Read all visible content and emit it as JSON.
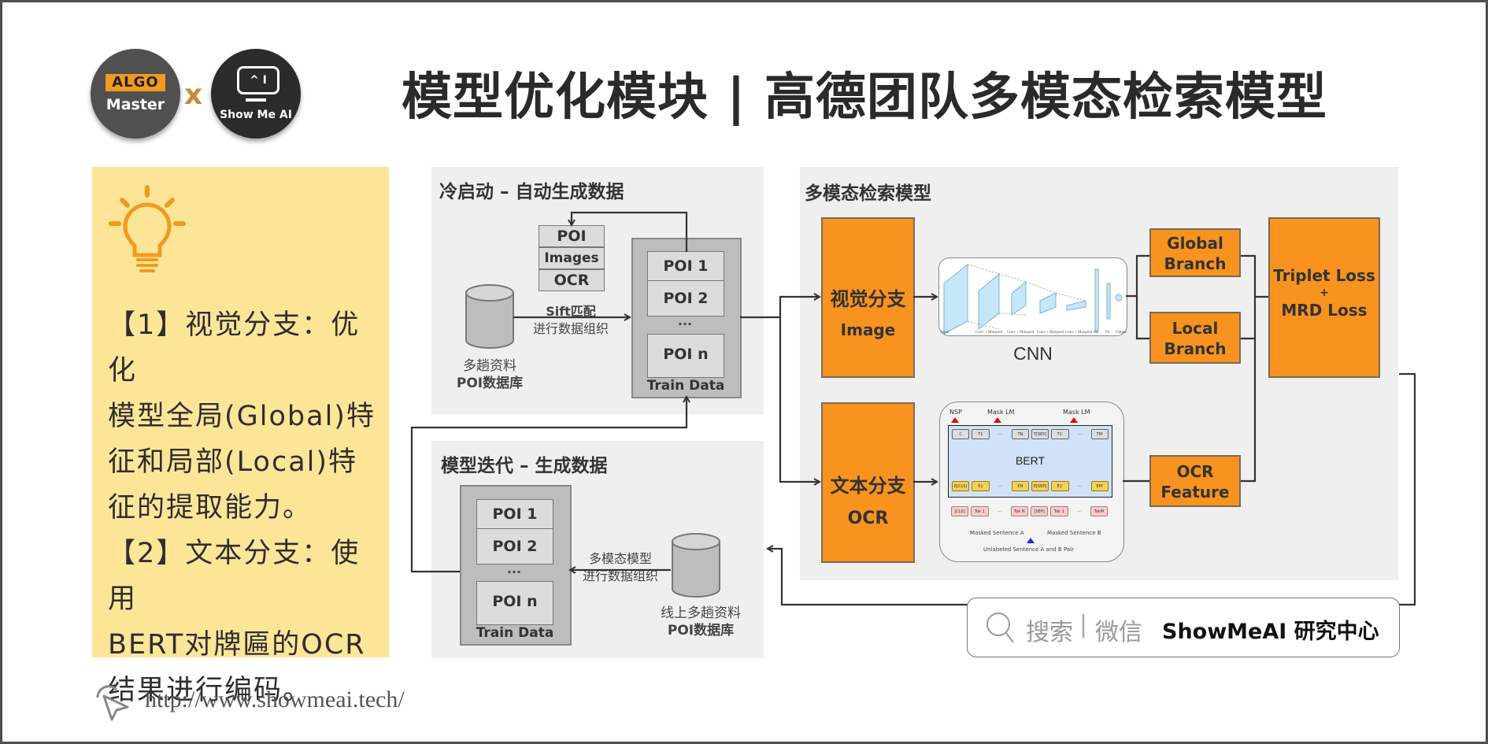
{
  "header": {
    "logo_left": {
      "tag": "ALGO",
      "name": "Master"
    },
    "logo_separator": "x",
    "logo_right": {
      "screen": "^ I",
      "name": "Show Me AI"
    },
    "title": "模型优化模块 | 高德团队多模态检索模型"
  },
  "note": {
    "icon": "lightbulb-icon",
    "lines": [
      "【1】视觉分支：优化",
      "模型全局(Global)特",
      "征和局部(Local)特",
      "征的提取能力。",
      "【2】文本分支：使用",
      "BERT对牌匾的OCR",
      "结果进行编码。"
    ]
  },
  "cold_start": {
    "title": "冷启动 – 自动生成数据",
    "record": [
      "POI",
      "Images",
      "OCR"
    ],
    "db_label_1": "多趟资料",
    "db_label_2": "POI数据库",
    "arrow_label_1": "Sift匹配",
    "arrow_label_2": "进行数据组织",
    "train_data": {
      "items": [
        "POI 1",
        "POI 2",
        "...",
        "POI n"
      ],
      "caption": "Train Data"
    }
  },
  "iteration": {
    "title": "模型迭代 – 生成数据",
    "train_data": {
      "items": [
        "POI 1",
        "POI 2",
        "...",
        "POI n"
      ],
      "caption": "Train Data"
    },
    "arrow_label_1": "多模态模型",
    "arrow_label_2": "进行数据组织",
    "db_label_1": "线上多趟资料",
    "db_label_2": "POI数据库"
  },
  "model": {
    "title": "多模态检索模型",
    "visual_branch": {
      "label": "视觉分支",
      "sub": "Image"
    },
    "text_branch": {
      "label": "文本分支",
      "sub": "OCR"
    },
    "cnn": {
      "caption": "CNN",
      "layer_labels": [
        "Input",
        "Conv + Maxpool",
        "Conv + Maxpool",
        "Conv + Maxpool",
        "Conv + Maxpool",
        "FC",
        "FC",
        "Output"
      ]
    },
    "bert": {
      "center": "BERT",
      "heads": [
        "NSP",
        "Mask LM",
        "Mask LM"
      ],
      "outputs": [
        "C",
        "T1",
        "...",
        "TN",
        "T[SEP]",
        "T1'",
        "...",
        "TM'"
      ],
      "embeddings": [
        "E[CLS]",
        "E1",
        "...",
        "EN",
        "E[SEP]",
        "E1'",
        "...",
        "EM'"
      ],
      "tokens": [
        "[CLS]",
        "Tok 1",
        "...",
        "Tok N",
        "[SEP]",
        "Tok 1",
        "...",
        "TokM"
      ],
      "sentence_a": "Masked Sentence A",
      "sentence_b": "Masked Sentence B",
      "pair": "Unlabeled Sentence A and B Pair"
    },
    "global_branch": "Global Branch",
    "local_branch": "Local Branch",
    "ocr_feature": "OCR Feature",
    "loss": {
      "line1": "Triplet Loss",
      "plus": "+",
      "line2": "MRD Loss"
    }
  },
  "footer": {
    "search_prefix": "搜索",
    "search_divider": "|",
    "search_channel": "微信",
    "search_brand": "ShowMeAI 研究中心",
    "url": "http://www.showmeai.tech/"
  },
  "colors": {
    "accent_orange": "#f7931e",
    "note_bg": "#fde598",
    "panel_bg": "#efefef",
    "frame": "#4e4e4e"
  }
}
